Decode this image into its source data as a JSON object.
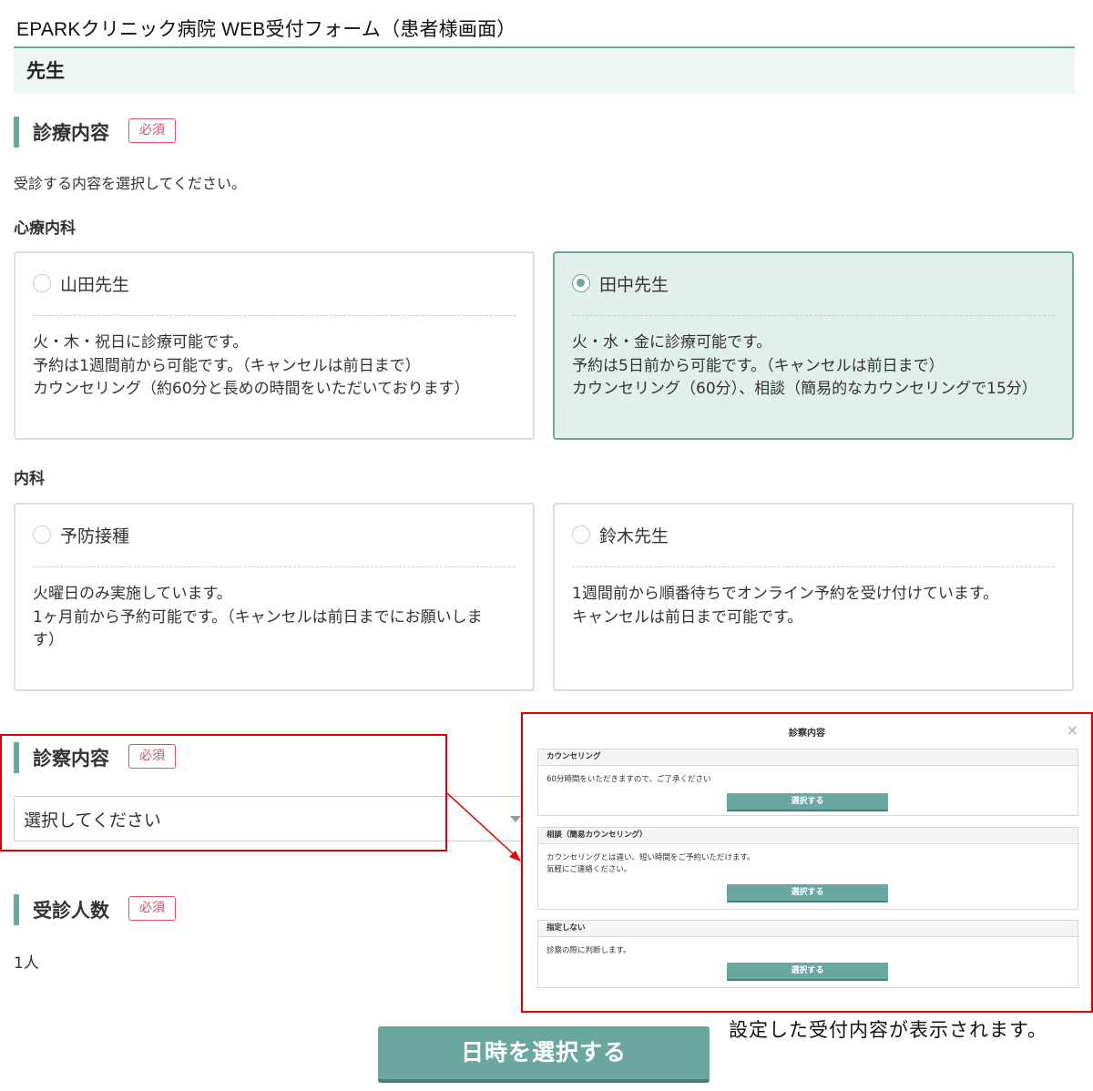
{
  "page_caption": "EPARKクリニック病院 WEB受付フォーム（患者様画面）",
  "doctor_bar_label": "先生",
  "treatment_section": {
    "title": "診療内容",
    "required_badge": "必須",
    "lead": "受診する内容を選択してください。"
  },
  "categories": [
    {
      "name": "心療内科",
      "cards": [
        {
          "title": "山田先生",
          "selected": false,
          "lines": [
            "火・木・祝日に診療可能です。",
            "予約は1週間前から可能です。（キャンセルは前日まで）",
            "カウンセリング（約60分と長めの時間をいただいております）"
          ]
        },
        {
          "title": "田中先生",
          "selected": true,
          "lines": [
            "火・水・金に診療可能です。",
            "予約は5日前から可能です。（キャンセルは前日まで）",
            "カウンセリング（60分）、相談（簡易的なカウンセリングで15分）"
          ]
        }
      ]
    },
    {
      "name": "内科",
      "cards": [
        {
          "title": "予防接種",
          "selected": false,
          "lines": [
            "火曜日のみ実施しています。",
            "1ヶ月前から予約可能です。（キャンセルは前日までにお願いします）"
          ]
        },
        {
          "title": "鈴木先生",
          "selected": false,
          "lines": [
            "1週間前から順番待ちでオンライン予約を受け付けています。",
            "キャンセルは前日まで可能です。"
          ]
        }
      ]
    }
  ],
  "exam_section": {
    "title": "診察内容",
    "required_badge": "必須",
    "select_value": "選択してください"
  },
  "patients_section": {
    "title": "受診人数",
    "required_badge": "必須",
    "value": "1人"
  },
  "modal": {
    "title": "診察内容",
    "close_symbol": "×",
    "options": [
      {
        "heading": "カウンセリング",
        "description": [
          "60分時間をいただきますので、ご了承ください"
        ],
        "button_label": "選択する"
      },
      {
        "heading": "相談（簡易カウンセリング）",
        "description": [
          "カウンセリングとは違い、短い時間をご予約いただけます。",
          "気軽にご連絡ください。"
        ],
        "button_label": "選択する"
      },
      {
        "heading": "指定しない",
        "description": [
          "診察の際に判断します。"
        ],
        "button_label": "選択する"
      }
    ]
  },
  "annotation_note": "設定した受付内容が表示されます。",
  "submit_label": "日時を選択する",
  "colors": {
    "accent": "#6aa89f",
    "selected_background": "#e2f0ec",
    "required": "#d9506c",
    "annotation": "#e00000"
  }
}
